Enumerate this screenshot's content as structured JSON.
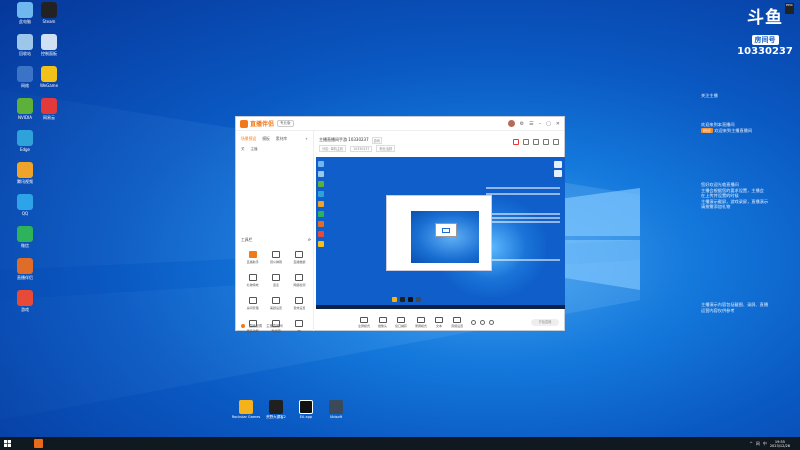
{
  "desktop": {
    "left_icons": [
      {
        "label": "此电脑",
        "color": "#6fb7ef",
        "icon": "computer-icon"
      },
      {
        "label": "回收站",
        "color": "#9cc7ea",
        "icon": "recycle-bin-icon"
      },
      {
        "label": "网络",
        "color": "#3b73c7",
        "icon": "network-icon"
      },
      {
        "label": "NVIDIA",
        "color": "#5db039",
        "icon": "nvidia-icon"
      },
      {
        "label": "Edge",
        "color": "#2ea2d9",
        "icon": "edge-icon"
      },
      {
        "label": "腾讯视频",
        "color": "#f0a32a",
        "icon": "video-icon"
      },
      {
        "label": "QQ",
        "color": "#2ea4e8",
        "icon": "qq-icon"
      },
      {
        "label": "微信",
        "color": "#2db45a",
        "icon": "wechat-icon"
      },
      {
        "label": "直播伴侣",
        "color": "#e06c2a",
        "icon": "live-icon"
      },
      {
        "label": "游戏",
        "color": "#e84a3a",
        "icon": "game-icon"
      }
    ],
    "second_col_icons": [
      {
        "label": "Steam",
        "color": "#222",
        "icon": "steam-icon"
      },
      {
        "label": "控制面板",
        "color": "#cfe0f5",
        "icon": "control-panel-icon"
      },
      {
        "label": "WeGame",
        "color": "#f2c21a",
        "icon": "wegame-icon"
      },
      {
        "label": "网易云",
        "color": "#e23a3a",
        "icon": "netease-icon"
      }
    ],
    "bottom_apps": [
      {
        "label": "Rockstar Games",
        "color": "#f6b21a",
        "icon": "rockstar-icon"
      },
      {
        "label": "荒野大镖客2",
        "color": "#202020",
        "icon": "rdr2-icon"
      },
      {
        "label": "EA app",
        "color": "#111",
        "icon": "ea-icon"
      },
      {
        "label": "Ubisoft",
        "color": "#3a4a5a",
        "icon": "ubisoft-icon"
      }
    ]
  },
  "overlay": {
    "epic_label": "EPIC",
    "brand": "斗鱼",
    "room_label": "房间号",
    "room_id": "10330237",
    "follow_label": "关注主播",
    "notice_line1": "欢迎来到本直播间",
    "badge_text": "粉丝",
    "badge_line": "欢迎来到主播直播间",
    "rules": [
      "您好欢迎光临直播间",
      "主播会根据您的要求设置，主播会",
      "在上传并设置的时候",
      "主播演示截屏，游戏录屏，直播演示",
      "请按需添加礼物"
    ],
    "rules2": [
      "主播演示内容包括截图、录屏、直播",
      "运营内容仅供参考"
    ]
  },
  "app": {
    "name": "直播伴侣",
    "version": "专业版",
    "side_tabs": [
      "场景预设",
      "模板",
      "素材库"
    ],
    "side_sub": [
      "关",
      "主播"
    ],
    "tools_title": "工具栏",
    "tools": [
      {
        "label": "直播助手",
        "orange": true
      },
      {
        "label": "观众弹幕",
        "orange": false
      },
      {
        "label": "直播数据",
        "orange": false
      },
      {
        "label": "礼物特效",
        "orange": false
      },
      {
        "label": "连麦",
        "orange": false
      },
      {
        "label": "网络检测",
        "orange": false
      },
      {
        "label": "房间管理",
        "orange": false
      },
      {
        "label": "美颜设置",
        "orange": false
      },
      {
        "label": "音效设置",
        "orange": false
      },
      {
        "label": "更多功能",
        "orange": false
      },
      {
        "label": "粉丝团",
        "orange": false
      },
      {
        "label": "PK",
        "orange": false
      }
    ],
    "side_footer": [
      "直播设置",
      "主播直播间"
    ],
    "stream_title": "主播直播间手游 10330237",
    "stream_tag": "游戏",
    "meta": [
      "分区: 单机主机",
      "10330237",
      "粉丝活跃"
    ],
    "bottom_tools": [
      "全屏模式",
      "摄像头",
      "窗口捕获",
      "录屏模式",
      "文本",
      "音频设置"
    ],
    "start_button": "开始直播"
  },
  "taskbar": {
    "clock_time": "19:55",
    "clock_date": "2023/12/26",
    "tray": [
      "^",
      "网",
      "中"
    ]
  }
}
